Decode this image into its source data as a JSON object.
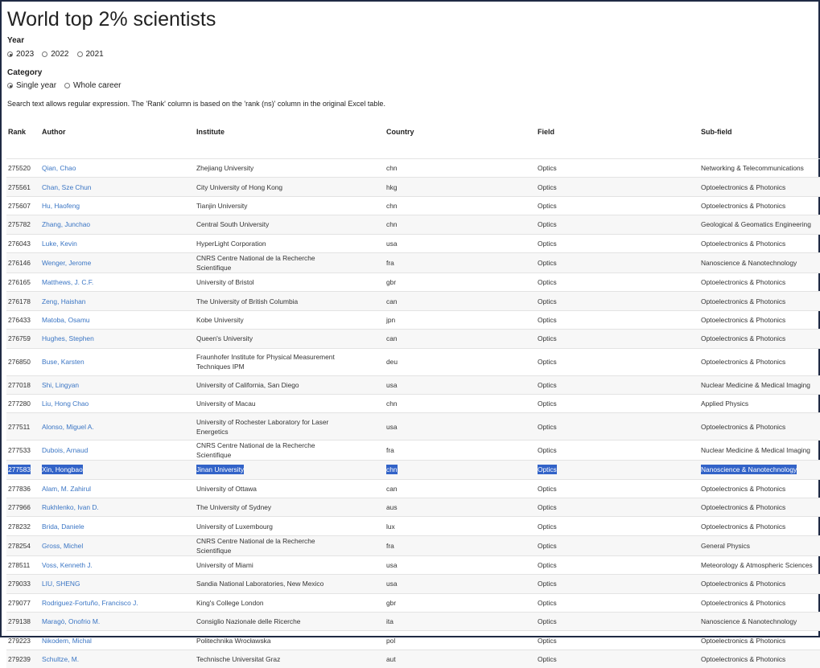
{
  "page": {
    "title": "World top 2% scientists"
  },
  "year": {
    "label": "Year",
    "options": [
      {
        "label": "2023",
        "checked": true
      },
      {
        "label": "2022",
        "checked": false
      },
      {
        "label": "2021",
        "checked": false
      }
    ]
  },
  "category": {
    "label": "Category",
    "options": [
      {
        "label": "Single year",
        "checked": true
      },
      {
        "label": "Whole career",
        "checked": false
      }
    ]
  },
  "note": "Search text allows regular expression. The 'Rank' column is based on the 'rank (ns)' column in the original Excel table.",
  "table": {
    "headers": [
      "Rank",
      "Author",
      "Institute",
      "Country",
      "Field",
      "Sub-field"
    ],
    "selected_row": 15,
    "rows": [
      [
        "275520",
        "Qian, Chao",
        "Zhejiang University",
        "chn",
        "Optics",
        "Networking & Telecommunications"
      ],
      [
        "275561",
        "Chan, Sze Chun",
        "City University of Hong Kong",
        "hkg",
        "Optics",
        "Optoelectronics & Photonics"
      ],
      [
        "275607",
        "Hu, Haofeng",
        "Tianjin University",
        "chn",
        "Optics",
        "Optoelectronics & Photonics"
      ],
      [
        "275782",
        "Zhang, Junchao",
        "Central South University",
        "chn",
        "Optics",
        "Geological & Geomatics Engineering"
      ],
      [
        "276043",
        "Luke, Kevin",
        "HyperLight Corporation",
        "usa",
        "Optics",
        "Optoelectronics & Photonics"
      ],
      [
        "276146",
        "Wenger, Jerome",
        "CNRS Centre National de la Recherche Scientifique",
        "fra",
        "Optics",
        "Nanoscience & Nanotechnology"
      ],
      [
        "276165",
        "Matthews, J. C.F.",
        "University of Bristol",
        "gbr",
        "Optics",
        "Optoelectronics & Photonics"
      ],
      [
        "276178",
        "Zeng, Haishan",
        "The University of British Columbia",
        "can",
        "Optics",
        "Optoelectronics & Photonics"
      ],
      [
        "276433",
        "Matoba, Osamu",
        "Kobe University",
        "jpn",
        "Optics",
        "Optoelectronics & Photonics"
      ],
      [
        "276759",
        "Hughes, Stephen",
        "Queen's University",
        "can",
        "Optics",
        "Optoelectronics & Photonics"
      ],
      [
        "276850",
        "Buse, Karsten",
        "Fraunhofer Institute for Physical Measurement Techniques IPM",
        "deu",
        "Optics",
        "Optoelectronics & Photonics"
      ],
      [
        "277018",
        "Shi, Lingyan",
        "University of California, San Diego",
        "usa",
        "Optics",
        "Nuclear Medicine & Medical Imaging"
      ],
      [
        "277280",
        "Liu, Hong Chao",
        "University of Macau",
        "chn",
        "Optics",
        "Applied Physics"
      ],
      [
        "277511",
        "Alonso, Miguel A.",
        "University of Rochester Laboratory for Laser Energetics",
        "usa",
        "Optics",
        "Optoelectronics & Photonics"
      ],
      [
        "277533",
        "Dubois, Arnaud",
        "CNRS Centre National de la Recherche Scientifique",
        "fra",
        "Optics",
        "Nuclear Medicine & Medical Imaging"
      ],
      [
        "277583",
        "Xin, Hongbao",
        "Jinan University",
        "chn",
        "Optics",
        "Nanoscience & Nanotechnology"
      ],
      [
        "277836",
        "Alam, M. Zahirul",
        "University of Ottawa",
        "can",
        "Optics",
        "Optoelectronics & Photonics"
      ],
      [
        "277966",
        "Rukhlenko, Ivan D.",
        "The University of Sydney",
        "aus",
        "Optics",
        "Optoelectronics & Photonics"
      ],
      [
        "278232",
        "Brida, Daniele",
        "University of Luxembourg",
        "lux",
        "Optics",
        "Optoelectronics & Photonics"
      ],
      [
        "278254",
        "Gross, Michel",
        "CNRS Centre National de la Recherche Scientifique",
        "fra",
        "Optics",
        "General Physics"
      ],
      [
        "278511",
        "Voss, Kenneth J.",
        "University of Miami",
        "usa",
        "Optics",
        "Meteorology & Atmospheric Sciences"
      ],
      [
        "279033",
        "LIU, SHENG",
        "Sandia National Laboratories, New Mexico",
        "usa",
        "Optics",
        "Optoelectronics & Photonics"
      ],
      [
        "279077",
        "Rodriguez-Fortuño, Francisco J.",
        "King's College London",
        "gbr",
        "Optics",
        "Optoelectronics & Photonics"
      ],
      [
        "279138",
        "Maragò, Onofrio M.",
        "Consiglio Nazionale delle Ricerche",
        "ita",
        "Optics",
        "Nanoscience & Nanotechnology"
      ],
      [
        "279223",
        "Nikodem, Michal",
        "Politechnika Wrocławska",
        "pol",
        "Optics",
        "Optoelectronics & Photonics"
      ],
      [
        "279239",
        "Schultze, M.",
        "Technische Universitat Graz",
        "aut",
        "Optics",
        "Optoelectronics & Photonics"
      ]
    ]
  },
  "colors": {
    "link": "#3a75c4",
    "selection": "#3263c8",
    "border": "#1f2a44"
  }
}
